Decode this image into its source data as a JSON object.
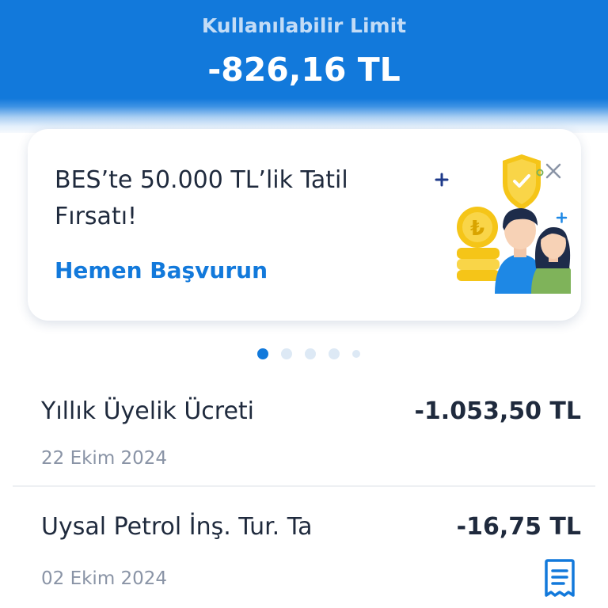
{
  "header": {
    "limit_label": "Kullanılabilir Limit",
    "limit_amount": "-826,16 TL"
  },
  "promo": {
    "title": "BES’te 50.000 TL’lik Tatil Fırsatı!",
    "cta": "Hemen Başvurun",
    "illustration": "family-savings-shield-illustration",
    "close_icon": "close-icon"
  },
  "pager": {
    "count": 5,
    "active_index": 0
  },
  "transactions": [
    {
      "name": "Yıllık Üyelik Ücreti",
      "amount": "-1.053,50 TL",
      "date": "22 Ekim 2024"
    },
    {
      "name": "Uysal Petrol İnş. Tur. Ta",
      "amount": "-16,75 TL",
      "date": "02 Ekim 2024",
      "icon": "receipt-icon"
    }
  ],
  "colors": {
    "primary": "#1279db",
    "text": "#1f2a3d",
    "muted": "#8a94a6",
    "accent_gold": "#f5c518"
  }
}
